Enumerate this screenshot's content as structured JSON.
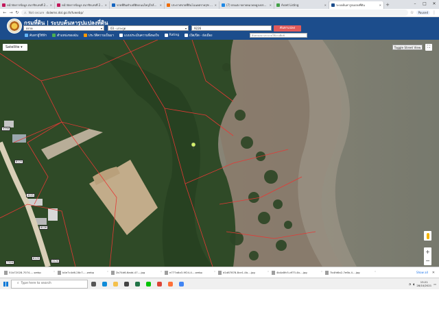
{
  "browser": {
    "tabs": [
      {
        "label": "หน้าจัดการข้อมูล สมาชิกเลขที่ 22775",
        "color": "#c2185b",
        "active": false
      },
      {
        "label": "หน้าจัดการข้อมูล สมาชิกเลขที่ 22775",
        "color": "#c2185b",
        "active": false
      },
      {
        "label": "ขายที่ดินทำเลดีติดถนนใหญ่ใกล้ชุมชน",
        "color": "#1565c0",
        "active": false
      },
      {
        "label": "ประกาศขายที่ดินโฉนดตราครุฑ - DDproperty",
        "color": "#ef6c00",
        "active": false
      },
      {
        "label": "(7) ตกแต่ง ขยายหมวดหมู่ลงประกาศ",
        "color": "#1e88e5",
        "active": false
      },
      {
        "label": "Asset Listing",
        "color": "#43a047",
        "active": false
      },
      {
        "label": "ระบบค้นหารูปแปลงที่ดิน",
        "color": "#1c4d8c",
        "active": true
      }
    ],
    "new_tab": "+",
    "window_controls": [
      "–",
      "□",
      "✕"
    ],
    "url_security": "Not secure",
    "url": "dolwms.dol.go.th/tvwebp/",
    "profile": "Paused"
  },
  "app": {
    "title": "กรมที่ดิน | ระบบค้นหารูปแปลงที่ดิน",
    "province": "ตราด",
    "district": "03 - เกาะกูด",
    "parcel_no": "9226",
    "search_label": "ค้นหาแปลง",
    "tools": [
      {
        "label": "ค้นหาผู้ใช้ฟ้า",
        "color": "#64b5f6"
      },
      {
        "label": "ตำแหน่งของฉัน",
        "color": "#4caf50"
      },
      {
        "label": "ประวัติความเป็นมา",
        "color": "#ff9800"
      },
      {
        "label": "แบบประเมินความพึงพอใจ",
        "color": "#ffffff"
      },
      {
        "label": "Rating",
        "color": "#ffffff"
      },
      {
        "label": "เปิด/ปิด - ผังเมือง",
        "color": "#ffffff"
      }
    ],
    "regulation_placeholder": "ค้นหาผลงานระบาดใช้งานพิมพ์"
  },
  "map": {
    "basemap": "Satellite",
    "street_view_label": "Toggle Street View",
    "fullscreen_icon": "⛶",
    "zoom_in": "+",
    "zoom_out": "−",
    "parcel_labels": [
      "4356",
      "8125",
      "4025",
      "8026",
      "4124",
      "8125",
      "7324"
    ]
  },
  "downloads": {
    "items": [
      "51b72028-7074-....webp",
      "b4e7c4d6-28c7-....webp",
      "2b74d6-6add-47....jpg",
      "e777a6a3-9f24-4....webp",
      "d1d87878-8ce1-4b....jpg",
      "4b4a8fc5-df73-4b....jpg",
      "7b4fd6a2-7e6b-4....jpg"
    ],
    "show_all": "Show all"
  },
  "taskbar": {
    "search_placeholder": "Type here to search",
    "apps": [
      {
        "icon": "task-view-icon",
        "color": "#555555"
      },
      {
        "icon": "edge-icon",
        "color": "#0f8bd8"
      },
      {
        "icon": "file-explorer-icon",
        "color": "#f4c04b"
      },
      {
        "icon": "store-icon",
        "color": "#444444"
      },
      {
        "icon": "excel-icon",
        "color": "#217346"
      },
      {
        "icon": "line-icon",
        "color": "#00c300"
      },
      {
        "icon": "chrome-icon",
        "color": "#db4437"
      },
      {
        "icon": "firefox-icon",
        "color": "#ff7139"
      },
      {
        "icon": "chrome-icon",
        "color": "#4285f4"
      }
    ],
    "time": "15:21",
    "date": "28/10/2021"
  }
}
